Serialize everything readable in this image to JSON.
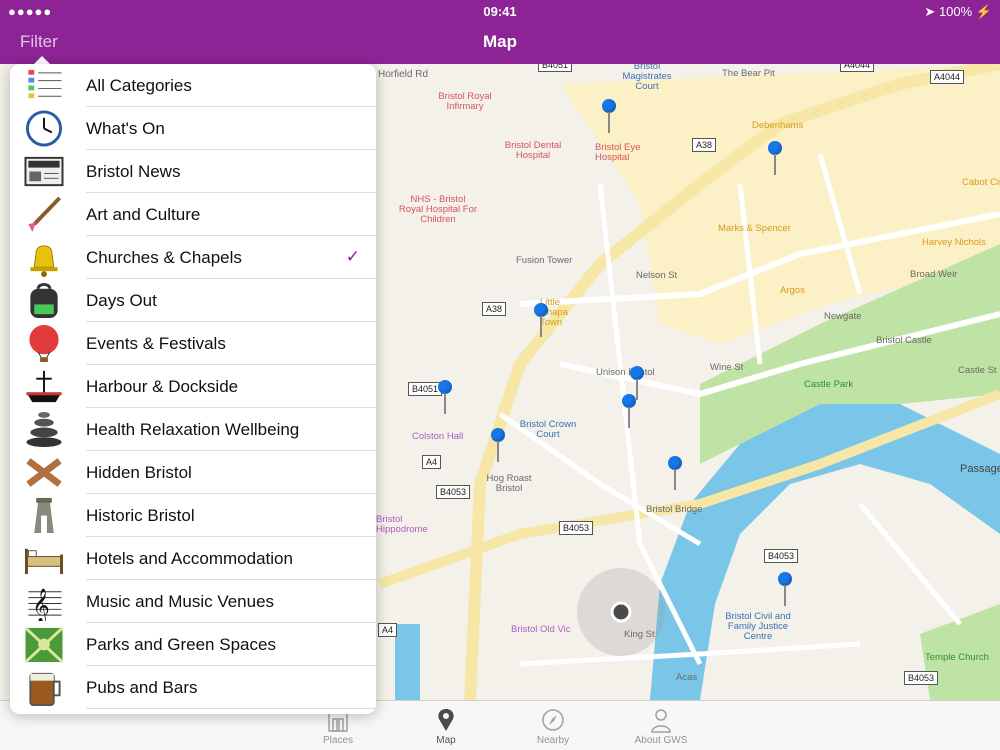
{
  "status": {
    "signal": "●●●●●",
    "time": "09:41",
    "battery": "100%"
  },
  "nav": {
    "filter_label": "Filter",
    "title": "Map"
  },
  "categories": [
    {
      "label": "All Categories",
      "icon": "list-icon",
      "checked": false
    },
    {
      "label": "What's On",
      "icon": "clock-icon",
      "checked": false
    },
    {
      "label": "Bristol News",
      "icon": "newspaper-icon",
      "checked": false
    },
    {
      "label": "Art and Culture",
      "icon": "paintbrush-icon",
      "checked": false
    },
    {
      "label": "Churches & Chapels",
      "icon": "bell-icon",
      "checked": true
    },
    {
      "label": "Days Out",
      "icon": "backpack-icon",
      "checked": false
    },
    {
      "label": "Events & Festivals",
      "icon": "balloon-icon",
      "checked": false
    },
    {
      "label": "Harbour & Dockside",
      "icon": "ship-icon",
      "checked": false
    },
    {
      "label": "Health Relaxation Wellbeing",
      "icon": "stones-icon",
      "checked": false
    },
    {
      "label": "Hidden Bristol",
      "icon": "crossed-sticks-icon",
      "checked": false
    },
    {
      "label": "Historic Bristol",
      "icon": "tower-icon",
      "checked": false
    },
    {
      "label": "Hotels and Accommodation",
      "icon": "bed-icon",
      "checked": false
    },
    {
      "label": "Music and Music Venues",
      "icon": "treble-clef-icon",
      "checked": false
    },
    {
      "label": "Parks and Green Spaces",
      "icon": "park-icon",
      "checked": false
    },
    {
      "label": "Pubs and Bars",
      "icon": "beer-icon",
      "checked": false
    }
  ],
  "check_mark": "✓",
  "map": {
    "labels": [
      {
        "text": "Bristol Royal Infirmary",
        "cls": "red"
      },
      {
        "text": "Bristol Dental Hospital",
        "cls": "red"
      },
      {
        "text": "Bristol Eye Hospital",
        "cls": "red"
      },
      {
        "text": "NHS - Bristol Royal Hospital For Children",
        "cls": "red"
      },
      {
        "text": "Bristol Magistrates Court",
        "cls": "blue"
      },
      {
        "text": "The Bear Pit",
        "cls": ""
      },
      {
        "text": "Debenhams",
        "cls": "orange"
      },
      {
        "text": "Marks & Spencer",
        "cls": "orange"
      },
      {
        "text": "Harvey Nichols",
        "cls": "orange"
      },
      {
        "text": "Cabot Circus",
        "cls": "orange"
      },
      {
        "text": "Argos",
        "cls": "orange"
      },
      {
        "text": "Fusion Tower",
        "cls": ""
      },
      {
        "text": "Little Chapa Town",
        "cls": "orange"
      },
      {
        "text": "Bristol Castle",
        "cls": ""
      },
      {
        "text": "Castle Park",
        "cls": "green"
      },
      {
        "text": "Unison Bristol",
        "cls": ""
      },
      {
        "text": "Colston Hall",
        "cls": "purple"
      },
      {
        "text": "Bristol Crown Court",
        "cls": "blue"
      },
      {
        "text": "Hog Roast Bristol",
        "cls": ""
      },
      {
        "text": "Bristol Bridge",
        "cls": ""
      },
      {
        "text": "Bristol Hippodrome",
        "cls": "purple"
      },
      {
        "text": "Bristol Old Vic",
        "cls": "purple"
      },
      {
        "text": "Bristol Civil and Family Justice Centre",
        "cls": "blue"
      },
      {
        "text": "Temple Church",
        "cls": "green"
      },
      {
        "text": "Acas",
        "cls": ""
      },
      {
        "text": "King St",
        "cls": ""
      },
      {
        "text": "Nelson St",
        "cls": ""
      },
      {
        "text": "Newgate",
        "cls": ""
      },
      {
        "text": "Wine St",
        "cls": ""
      },
      {
        "text": "Broad Weir",
        "cls": ""
      },
      {
        "text": "Passage",
        "cls": ""
      },
      {
        "text": "Castle St",
        "cls": ""
      },
      {
        "text": "Horfield Rd",
        "cls": ""
      }
    ],
    "road_signs": [
      "B4051",
      "A4044",
      "A4044",
      "A38",
      "A38",
      "B4051",
      "A4",
      "B4053",
      "B4053",
      "B4053",
      "A4",
      "B4053"
    ]
  },
  "tabs": [
    {
      "label": "Places",
      "icon": "building-icon",
      "active": false
    },
    {
      "label": "Map",
      "icon": "map-pin-icon",
      "active": true
    },
    {
      "label": "Nearby",
      "icon": "compass-icon",
      "active": false
    },
    {
      "label": "About GWS",
      "icon": "person-icon",
      "active": false
    }
  ],
  "colors": {
    "brand": "#8c2496",
    "pin": "#1678e8",
    "water": "#7ac6e9",
    "park": "#bfe3a5"
  }
}
